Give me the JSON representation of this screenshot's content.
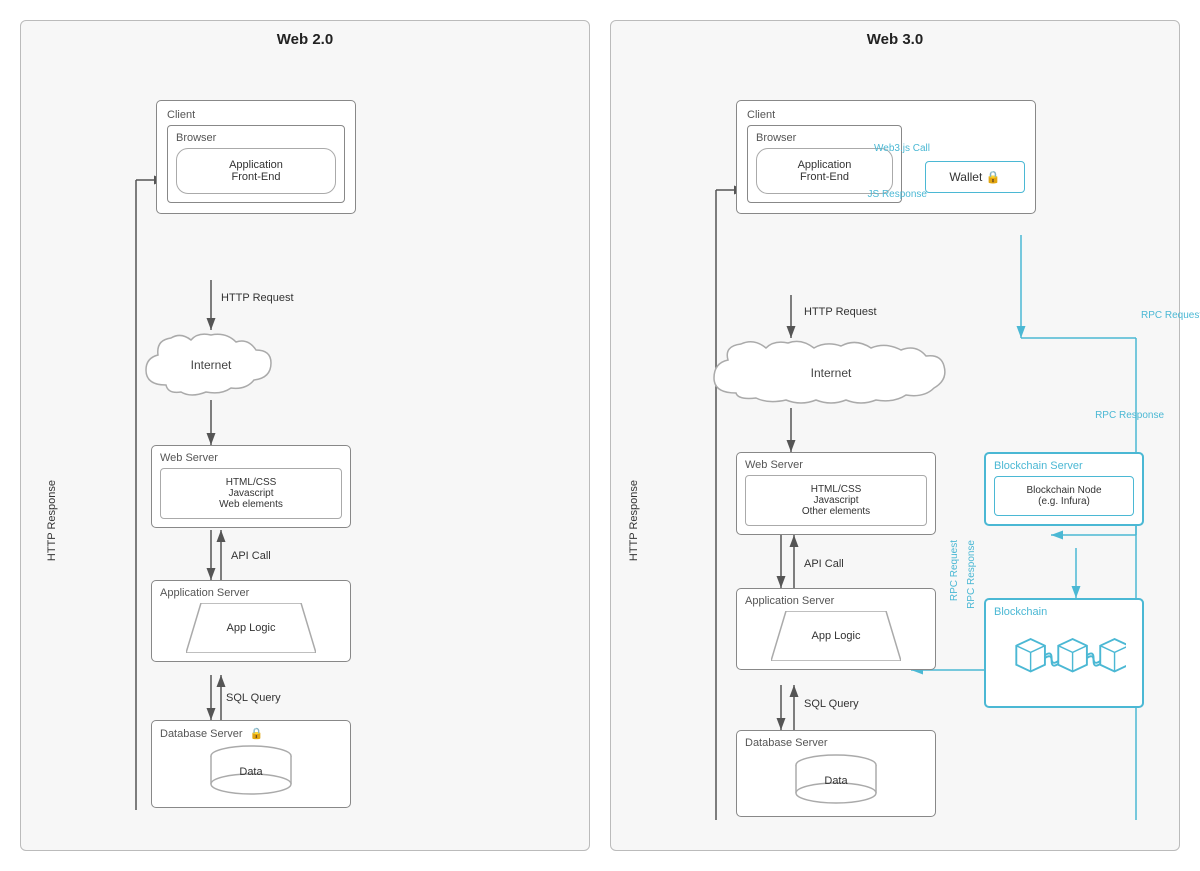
{
  "web2": {
    "title": "Web 2.0",
    "client_label": "Client",
    "browser_label": "Browser",
    "frontend_label": "Application\nFront-End",
    "internet_label": "Internet",
    "http_request": "HTTP Request",
    "http_response": "HTTP Response",
    "webserver_label": "Web Server",
    "webserver_content": "HTML/CSS\nJavascript\nWeb elements",
    "api_call": "API Call",
    "appserver_label": "Application Server",
    "applogic_label": "App Logic",
    "sql_query": "SQL Query",
    "dbserver_label": "Database Server",
    "data_label": "Data"
  },
  "web3": {
    "title": "Web 3.0",
    "client_label": "Client",
    "browser_label": "Browser",
    "frontend_label": "Application\nFront-End",
    "wallet_label": "Wallet",
    "web3js_call": "Web3.js Call",
    "js_response": "JS Response",
    "internet_label": "Internet",
    "http_request": "HTTP Request",
    "http_response": "HTTP Response",
    "rpc_request_right": "RPC Request",
    "rpc_response_right": "RPC Response",
    "rpc_request_mid": "RPC Request",
    "rpc_response_mid": "RPC Response",
    "webserver_label": "Web Server",
    "webserver_content": "HTML/CSS\nJavascript\nOther elements",
    "api_call": "API Call",
    "appserver_label": "Application Server",
    "applogic_label": "App Logic",
    "sql_query": "SQL Query",
    "dbserver_label": "Database Server",
    "data_label": "Data",
    "blockchain_server_label": "Blockchain Server",
    "blockchain_node_label": "Blockchain Node\n(e.g. Infura)",
    "blockchain_label": "Blockchain"
  },
  "colors": {
    "blue": "#4bb8d4",
    "border": "#888",
    "bg": "#f7f7f7",
    "text": "#333"
  }
}
